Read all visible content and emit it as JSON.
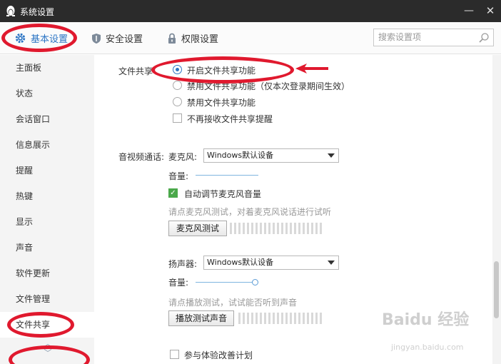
{
  "window": {
    "title": "系统设置",
    "minimize_glyph": "—",
    "close_glyph": "✕"
  },
  "tabs": [
    {
      "label": "基本设置",
      "icon": "gear-icon",
      "active": true
    },
    {
      "label": "安全设置",
      "icon": "shield-icon",
      "active": false
    },
    {
      "label": "权限设置",
      "icon": "lock-icon",
      "active": false
    }
  ],
  "search": {
    "placeholder": "搜索设置项"
  },
  "sidebar": {
    "items": [
      {
        "label": "主面板"
      },
      {
        "label": "状态"
      },
      {
        "label": "会话窗口"
      },
      {
        "label": "信息展示"
      },
      {
        "label": "提醒"
      },
      {
        "label": "热键"
      },
      {
        "label": "显示"
      },
      {
        "label": "声音"
      },
      {
        "label": "软件更新"
      },
      {
        "label": "文件管理"
      },
      {
        "label": "文件共享",
        "active": true
      }
    ]
  },
  "file_share": {
    "section_label": "文件共享",
    "options": [
      {
        "label": "开启文件共享功能",
        "selected": true
      },
      {
        "label": "禁用文件共享功能（仅本次登录期间生效）",
        "selected": false
      },
      {
        "label": "禁用文件共享功能",
        "selected": false
      }
    ],
    "no_reminder_label": "不再接收文件共享提醒",
    "no_reminder_checked": false
  },
  "av_call": {
    "section_label": "音视频通话:",
    "mic_label": "麦克风:",
    "mic_device": "Windows默认设备",
    "mic_volume_label": "音量:",
    "auto_adjust_label": "自动调节麦克风音量",
    "auto_adjust_checked": true,
    "mic_hint": "请点麦克风测试，对着麦克风说话进行试听",
    "mic_test_button": "麦克风测试",
    "speaker_label": "扬声器:",
    "speaker_device": "Windows默认设备",
    "speaker_volume_label": "音量:",
    "speaker_hint": "请点播放测试，试试能否听到声音",
    "speaker_test_button": "播放测试声音",
    "join_program_label": "参与体验改善计划",
    "join_program_checked": false
  },
  "watermark": {
    "text": "Baidu 经验",
    "sub": "jingyan.baidu.com"
  },
  "colors": {
    "accent": "#2b74c4",
    "titlebar": "#2b2b2b",
    "annotation": "#e0192e",
    "check_green": "#4aa84a"
  }
}
